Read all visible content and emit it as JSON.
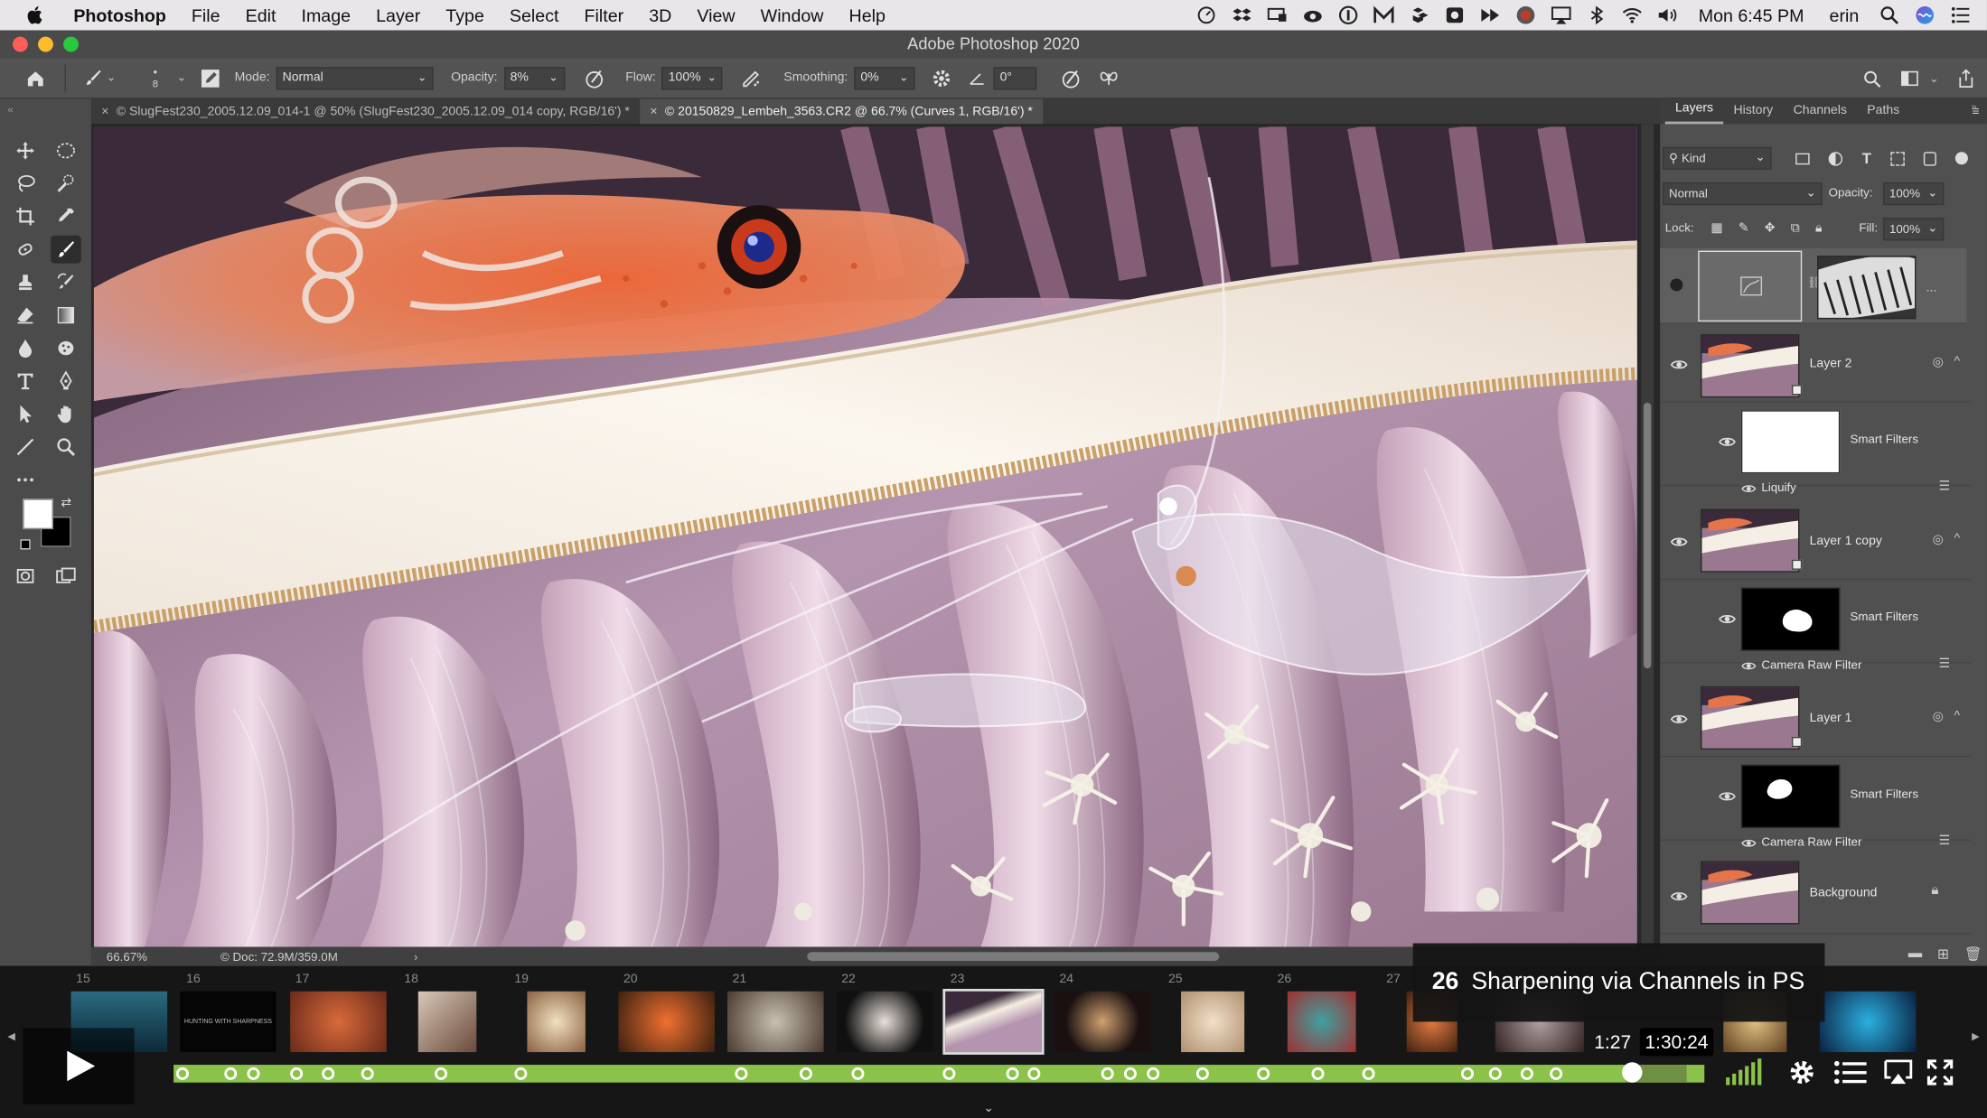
{
  "menubar": {
    "app_name": "Photoshop",
    "items": [
      "File",
      "Edit",
      "Image",
      "Layer",
      "Type",
      "Select",
      "Filter",
      "3D",
      "View",
      "Window",
      "Help"
    ],
    "clock": "Mon 6:45 PM",
    "user": "erin",
    "status_icons": [
      "gauge-icon",
      "dropbox-icon",
      "display-icon",
      "creative-cloud-icon",
      "onepassword-icon",
      "m-app-icon",
      "box-icon",
      "camera-icon",
      "forward-icon",
      "record-icon",
      "airplay-icon",
      "bluetooth-icon",
      "wifi-icon",
      "volume-icon"
    ]
  },
  "window": {
    "title": "Adobe Photoshop 2020"
  },
  "options_bar": {
    "brush_size": "8",
    "mode_label": "Mode:",
    "mode_value": "Normal",
    "opacity_label": "Opacity:",
    "opacity_value": "8%",
    "flow_label": "Flow:",
    "flow_value": "100%",
    "smoothing_label": "Smoothing:",
    "smoothing_value": "0%",
    "angle_value": "0°"
  },
  "document_tabs": [
    {
      "label": "© SlugFest230_2005.12.09_014-1 @ 50% (SlugFest230_2005.12.09_014 copy, RGB/16') *",
      "active": false
    },
    {
      "label": "© 20150829_Lembeh_3563.CR2 @ 66.7% (Curves 1, RGB/16') *",
      "active": true
    }
  ],
  "status_bar": {
    "zoom": "66.67%",
    "doc_info": "© Doc: 72.9M/359.0M",
    "arrow": "›"
  },
  "panels": {
    "tabs": [
      "Layers",
      "History",
      "Channels",
      "Paths"
    ],
    "active_tab": "Layers",
    "filter_kind": "Kind",
    "blend_mode": "Normal",
    "opacity_label": "Opacity:",
    "opacity_value": "100%",
    "lock_label": "Lock:",
    "fill_label": "Fill:",
    "fill_value": "100%",
    "more": "...",
    "layers": [
      {
        "name": "Layer 2",
        "type": "smart-object"
      },
      {
        "name": "Smart Filters",
        "filter": "Liquify"
      },
      {
        "name": "Layer 1 copy",
        "type": "smart-object"
      },
      {
        "name": "Smart Filters",
        "filter": "Camera Raw Filter"
      },
      {
        "name": "Layer 1",
        "type": "smart-object"
      },
      {
        "name": "Smart Filters",
        "filter": "Camera Raw Filter"
      },
      {
        "name": "Background",
        "type": "locked"
      }
    ]
  },
  "video": {
    "chapter_number": "26",
    "chapter_title": "Sharpening via Channels in PS",
    "current_time": "1:27",
    "duration": "1:30:24",
    "progress_fraction": 0.953,
    "filmstrip_numbers": [
      "15",
      "16",
      "17",
      "18",
      "19",
      "20",
      "21",
      "22",
      "23",
      "24",
      "25",
      "26",
      "27"
    ],
    "second_frame_text": "HUNTING WITH SHARPNESS",
    "accent_color": "#8bc34a"
  }
}
